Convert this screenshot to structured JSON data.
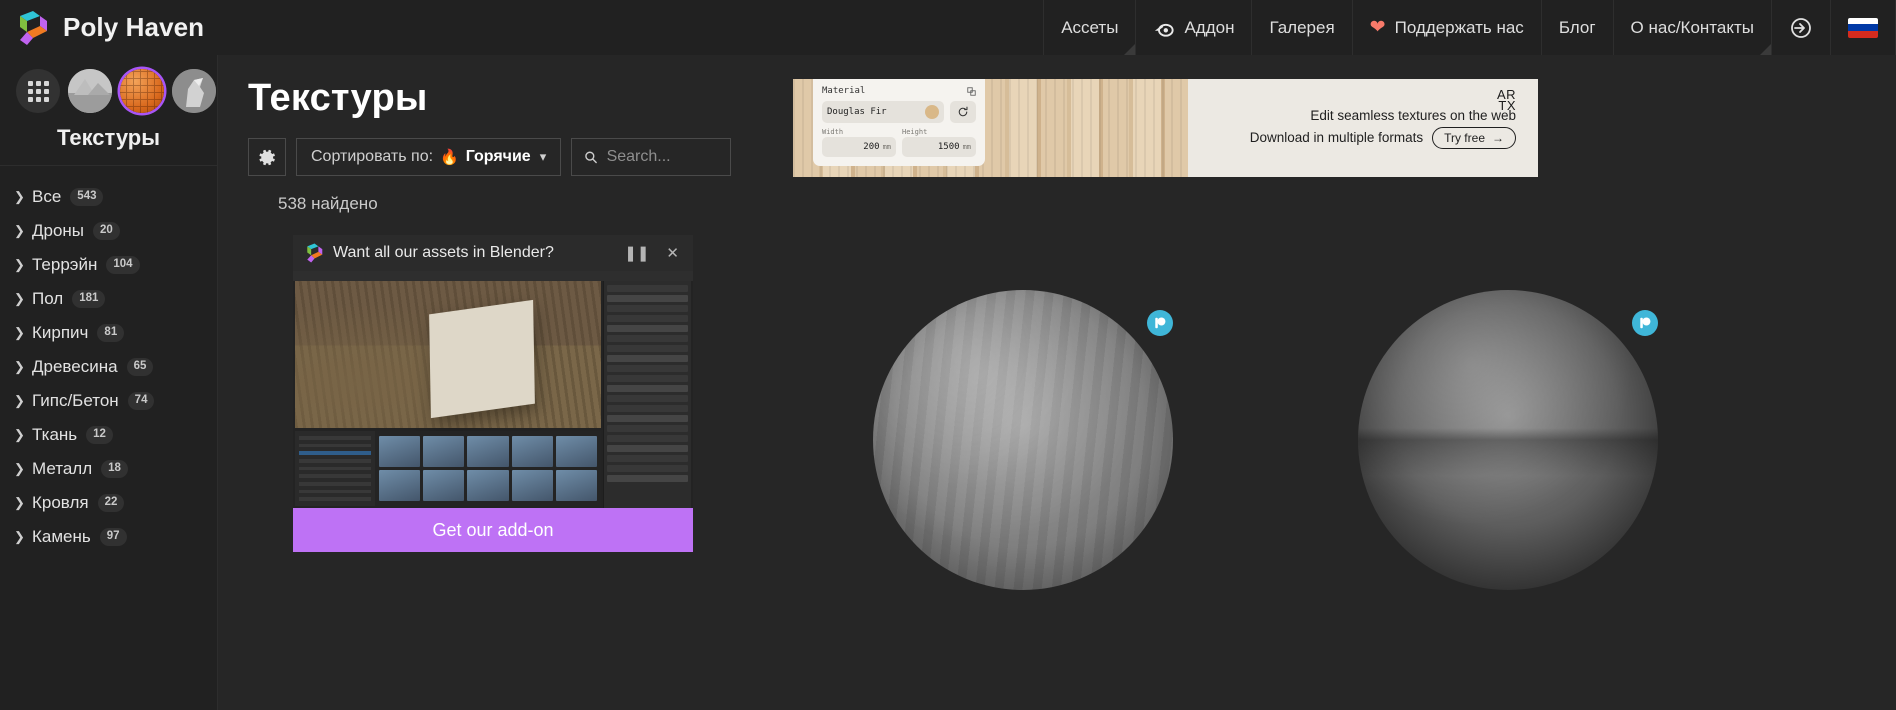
{
  "brand": {
    "name": "Poly Haven",
    "logo_icon": "polyhaven-logo-icon"
  },
  "topnav": {
    "items": [
      {
        "label": "Ассеты",
        "icon": null,
        "active": true
      },
      {
        "label": "Аддон",
        "icon": "blender-icon",
        "active": false
      },
      {
        "label": "Галерея",
        "icon": null,
        "active": false
      },
      {
        "label": "Поддержать нас",
        "icon": "heart-icon",
        "active": false
      },
      {
        "label": "Блог",
        "icon": null,
        "active": false
      },
      {
        "label": "О нас/Контакты",
        "icon": null,
        "active": true
      }
    ],
    "signin_icon": "sign-in-icon",
    "language_flag": "russian-flag-icon"
  },
  "sidebar": {
    "categories": [
      {
        "name": "all-assets",
        "icon": "grid-icon",
        "selected": false
      },
      {
        "name": "hdris",
        "icon": "hdri-thumbnail-icon",
        "selected": false
      },
      {
        "name": "textures",
        "icon": "texture-sphere-icon",
        "selected": true
      },
      {
        "name": "models",
        "icon": "model-thumbnail-icon",
        "selected": false
      }
    ],
    "title": "Текстуры",
    "items": [
      {
        "label": "Все",
        "count": "543"
      },
      {
        "label": "Дроны",
        "count": "20"
      },
      {
        "label": "Террэйн",
        "count": "104"
      },
      {
        "label": "Пол",
        "count": "181"
      },
      {
        "label": "Кирпич",
        "count": "81"
      },
      {
        "label": "Древесина",
        "count": "65"
      },
      {
        "label": "Гипс/Бетон",
        "count": "74"
      },
      {
        "label": "Ткань",
        "count": "12"
      },
      {
        "label": "Металл",
        "count": "18"
      },
      {
        "label": "Кровля",
        "count": "22"
      },
      {
        "label": "Камень",
        "count": "97"
      }
    ]
  },
  "main": {
    "page_title": "Текстуры",
    "settings_icon": "gear-icon",
    "sort": {
      "label": "Сортировать по:",
      "icon": "flame-icon",
      "value": "Горячие",
      "caret": "chevron-down-icon"
    },
    "search": {
      "icon": "search-icon",
      "placeholder": "Search...",
      "value": ""
    },
    "results_count": "538 найдено"
  },
  "ad": {
    "material_panel": {
      "title": "Material",
      "material_name": "Douglas Fir",
      "refresh_icon": "refresh-icon",
      "width_label": "Width",
      "width_value": "200",
      "width_unit": "mm",
      "height_label": "Height",
      "height_value": "1500",
      "height_unit": "mm"
    },
    "logo": "ARTX",
    "line1": "Edit seamless textures on the web",
    "line2": "Download in multiple formats",
    "cta": "Try free",
    "cta_arrow": "arrow-right-icon"
  },
  "promo": {
    "logo_icon": "polyhaven-logo-icon",
    "title": "Want all our assets in Blender?",
    "pause_icon": "pause-icon",
    "close_icon": "close-icon",
    "cta": "Get our add-on",
    "cta_color": "#be72f5"
  },
  "cards": [
    {
      "name": "texture-card-1",
      "badge_icon": "patreon-badge-icon",
      "badge_color": "#3fb6d8"
    },
    {
      "name": "texture-card-2",
      "badge_icon": "patreon-badge-icon",
      "badge_color": "#3fb6d8"
    }
  ]
}
